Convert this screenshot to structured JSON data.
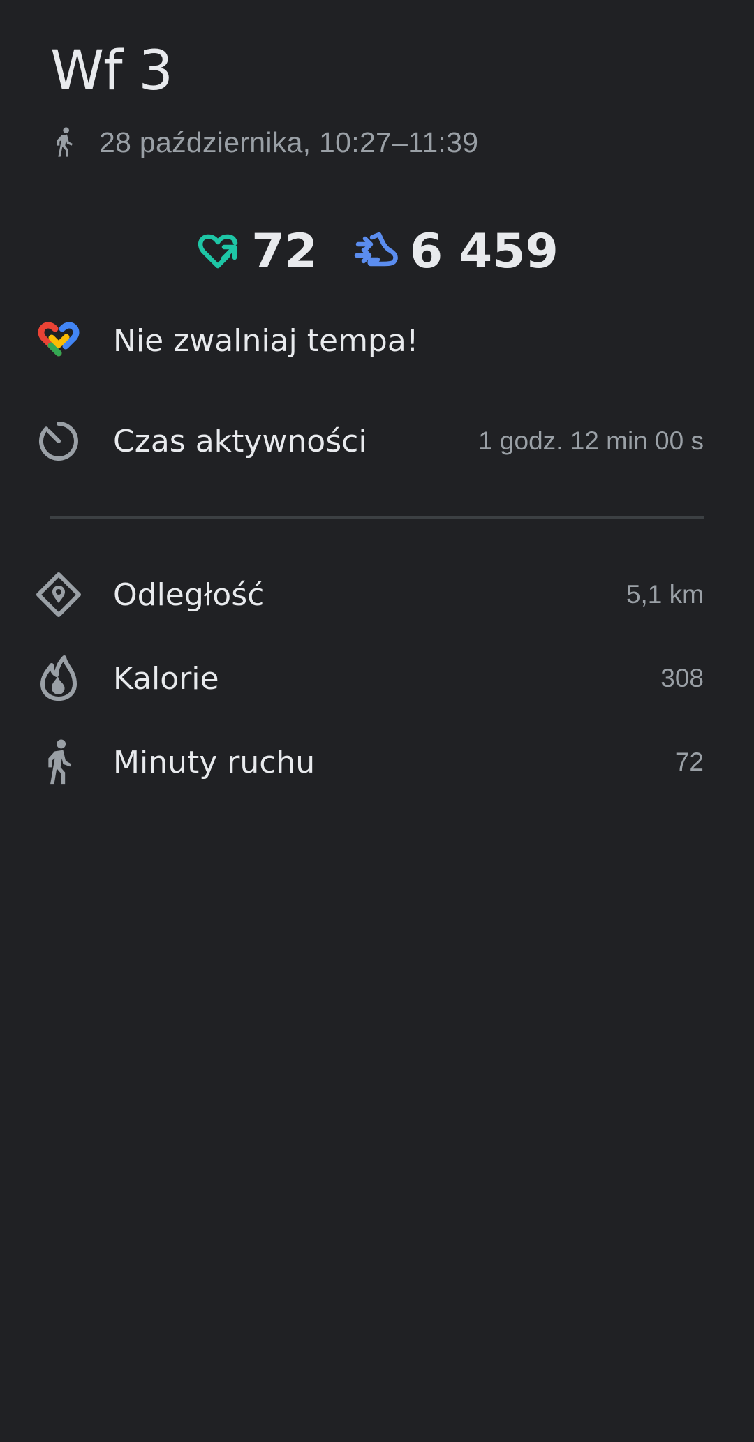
{
  "header": {
    "title": "Wf 3",
    "subtitle": "28 października, 10:27–11:39",
    "subtitle_icon": "walking-icon"
  },
  "stats": {
    "heart_points": {
      "icon": "heart-points-icon",
      "value": "72",
      "color": "#1ec6a6"
    },
    "steps": {
      "icon": "steps-icon",
      "value": "6 459",
      "color": "#5b8def"
    }
  },
  "goal": {
    "icon": "google-fit-logo",
    "text": "Nie zwalniaj tempa!"
  },
  "active_time": {
    "icon": "timer-icon",
    "label": "Czas aktywności",
    "value": "1 godz. 12 min 00 s"
  },
  "metrics": [
    {
      "icon": "location-diamond-icon",
      "label": "Odległość",
      "value": "5,1 km"
    },
    {
      "icon": "flame-icon",
      "label": "Kalorie",
      "value": "308"
    },
    {
      "icon": "walking-icon",
      "label": "Minuty ruchu",
      "value": "72"
    }
  ],
  "colors": {
    "background": "#202124",
    "text_primary": "#e8eaed",
    "text_secondary": "#9aa0a6",
    "icon_gray": "#9aa0a6",
    "divider": "#3c4043"
  }
}
